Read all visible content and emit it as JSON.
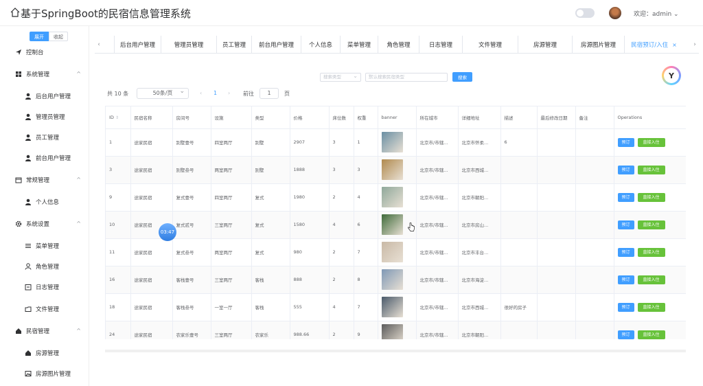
{
  "header": {
    "title": "基于SpringBoot的民宿信息管理系统",
    "user_label": "欢迎：admin ⌄"
  },
  "sidebar": {
    "expand_label": "展开",
    "collapse_label": "收起",
    "items": [
      {
        "label": "控制台",
        "icon": "send-icon",
        "level": "top"
      },
      {
        "label": "系统管理",
        "icon": "grid-icon",
        "level": "top",
        "chevron": "^"
      },
      {
        "label": "后台用户管理",
        "icon": "user-icon",
        "level": "sub"
      },
      {
        "label": "管理员管理",
        "icon": "user-icon",
        "level": "sub"
      },
      {
        "label": "员工管理",
        "icon": "user-icon",
        "level": "sub"
      },
      {
        "label": "前台用户管理",
        "icon": "user-icon",
        "level": "sub"
      },
      {
        "label": "常规管理",
        "icon": "calendar-icon",
        "level": "top",
        "chevron": "^"
      },
      {
        "label": "个人信息",
        "icon": "user-icon",
        "level": "sub"
      },
      {
        "label": "系统设置",
        "icon": "gear-icon",
        "level": "top",
        "chevron": "^"
      },
      {
        "label": "菜单管理",
        "icon": "sliders-icon",
        "level": "sub"
      },
      {
        "label": "角色管理",
        "icon": "person-outline-icon",
        "level": "sub"
      },
      {
        "label": "日志管理",
        "icon": "calendar-outline-icon",
        "level": "sub"
      },
      {
        "label": "文件管理",
        "icon": "folder-icon",
        "level": "sub"
      },
      {
        "label": "民宿管理",
        "icon": "home-icon",
        "level": "top",
        "chevron": "^"
      },
      {
        "label": "房源管理",
        "icon": "home-icon",
        "level": "sub"
      },
      {
        "label": "房源图片管理",
        "icon": "image-icon",
        "level": "sub"
      }
    ]
  },
  "tabs": {
    "prev": "‹",
    "next": "›",
    "items": [
      {
        "label": "后台用户管理"
      },
      {
        "label": "管理员管理"
      },
      {
        "label": "员工管理"
      },
      {
        "label": "前台用户管理"
      },
      {
        "label": "个人信息"
      },
      {
        "label": "菜单管理"
      },
      {
        "label": "角色管理"
      },
      {
        "label": "日志管理"
      },
      {
        "label": "文件管理"
      },
      {
        "label": "房源管理"
      },
      {
        "label": "房源图片管理"
      },
      {
        "label": "民宿预订/入住",
        "active": true,
        "close": "×"
      }
    ]
  },
  "search": {
    "type_placeholder": "搜索类型",
    "keyword_placeholder": "默认搜索民宿类型",
    "button_label": "搜索"
  },
  "pagination": {
    "total": "共 10 条",
    "page_size": "50条/页",
    "prev": "‹",
    "current": "1",
    "next": "›",
    "goto_label": "前往",
    "goto_value": "1",
    "page_unit": "页"
  },
  "table": {
    "columns": [
      "ID",
      "民宿名称",
      "房间号",
      "设施",
      "类型",
      "价格",
      "床位数",
      "权重",
      "banner",
      "所在城市",
      "详细地址",
      "描述",
      "最后修改日期",
      "备注",
      "Operations"
    ],
    "weight_header_suffix": "⇕",
    "rows": [
      {
        "id": "1",
        "name": "途家民宿",
        "room": "别墅壹号",
        "facility": "四室两厅",
        "type": "别墅",
        "price": "2907",
        "beds": "3",
        "weight": "1",
        "banner_color": "#6a8fa3",
        "city": "北京市/市辖...",
        "address": "北京市怀柔...",
        "desc": "6",
        "modified": "",
        "remark": ""
      },
      {
        "id": "3",
        "name": "途家民宿",
        "room": "别墅叁号",
        "facility": "两室两厅",
        "type": "别墅",
        "price": "1888",
        "beds": "3",
        "weight": "3",
        "banner_color": "#b08a4e",
        "city": "北京市/市辖...",
        "address": "北京市西城...",
        "desc": "",
        "modified": "",
        "remark": ""
      },
      {
        "id": "9",
        "name": "途家民宿",
        "room": "复式壹号",
        "facility": "四室两厅",
        "type": "复式",
        "price": "1980",
        "beds": "2",
        "weight": "4",
        "banner_color": "#8fa89a",
        "city": "北京市/市辖...",
        "address": "北京市朝阳...",
        "desc": "",
        "modified": "",
        "remark": ""
      },
      {
        "id": "10",
        "name": "途家民宿",
        "room": "复式贰号",
        "facility": "三室两厅",
        "type": "复式",
        "price": "1580",
        "beds": "4",
        "weight": "6",
        "banner_color": "#3f6b3a",
        "city": "北京市/市辖...",
        "address": "北京市房山...",
        "desc": "",
        "modified": "",
        "remark": ""
      },
      {
        "id": "11",
        "name": "途家民宿",
        "room": "复式叁号",
        "facility": "两室两厅",
        "type": "复式",
        "price": "980",
        "beds": "2",
        "weight": "7",
        "banner_color": "#c9b9a6",
        "city": "北京市/市辖...",
        "address": "北京市丰台...",
        "desc": "",
        "modified": "",
        "remark": ""
      },
      {
        "id": "16",
        "name": "途家民宿",
        "room": "客栈壹号",
        "facility": "三室两厅",
        "type": "客栈",
        "price": "888",
        "beds": "2",
        "weight": "8",
        "banner_color": "#7f98b5",
        "city": "北京市/市辖...",
        "address": "北京市海淀...",
        "desc": "",
        "modified": "",
        "remark": ""
      },
      {
        "id": "18",
        "name": "途家民宿",
        "room": "客栈叁号",
        "facility": "一室一厅",
        "type": "客栈",
        "price": "555",
        "beds": "4",
        "weight": "7",
        "banner_color": "#4a5a6b",
        "city": "北京市/市辖...",
        "address": "北京市西城...",
        "desc": "很好的房子",
        "modified": "",
        "remark": ""
      },
      {
        "id": "24",
        "name": "途家民宿",
        "room": "农家乐壹号",
        "facility": "三室两厅",
        "type": "农家乐",
        "price": "988.66",
        "beds": "2",
        "weight": "9",
        "banner_color": "#5b5b5b",
        "city": "北京市/市辖...",
        "address": "北京市朝阳...",
        "desc": "",
        "modified": "",
        "remark": ""
      }
    ],
    "book_label": "预订",
    "checkin_label": "直接入住"
  },
  "overlay": {
    "timer_text": "03:47"
  },
  "colors": {
    "primary": "#409eff",
    "success": "#67c23a"
  }
}
